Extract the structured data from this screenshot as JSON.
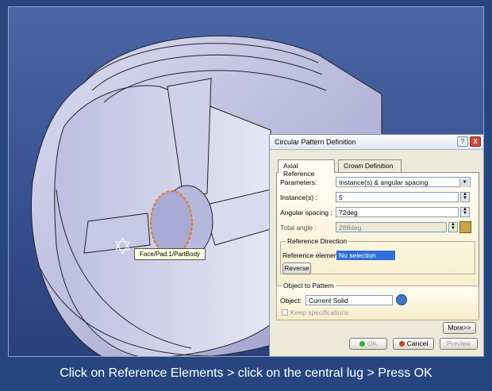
{
  "tooltip": "Face/Pad.1/PartBody",
  "caption": "Click on Reference Elements > click on the central lug > Press OK",
  "dialog": {
    "title": "Circular Pattern Definition",
    "help_icon": "question-icon",
    "close_label": "X",
    "tabs": [
      "Axial Reference",
      "Crown Definition"
    ],
    "parameters_label": "Parameters:",
    "parameters_value": "Instance(s) & angular spacing",
    "instances_label": "Instance(s) :",
    "instances_value": "5",
    "angular_label": "Angular spacing :",
    "angular_value": "72deg",
    "total_label": "Total angle :",
    "total_value": "288deg",
    "ref_dir_title": "Reference Direction",
    "ref_element_label": "Reference element:",
    "ref_element_value": "No selection",
    "reverse_label": "Reverse",
    "object_title": "Object to Pattern",
    "object_label": "Object:",
    "object_value": "Current Solid",
    "keep_spec_label": "Keep specifications",
    "more_label": "More>>",
    "ok_label": "OK",
    "cancel_label": "Cancel",
    "preview_label": "Preview"
  },
  "colors": {
    "background": "#27457f",
    "ok_dot": "#2fae3f",
    "cancel_dot": "#d23a2a",
    "selection": "#2f6fd6"
  }
}
